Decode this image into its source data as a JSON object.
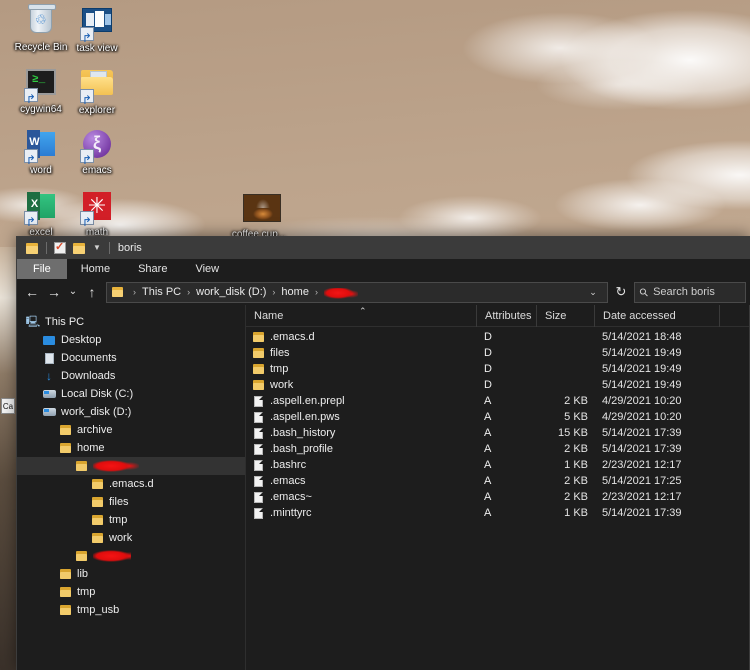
{
  "desktop": {
    "icons": [
      {
        "label": "Recycle Bin",
        "icon": "recycle-bin-icon"
      },
      {
        "label": "task view",
        "icon": "task-view-icon"
      },
      {
        "label": "cygwin64",
        "icon": "cygwin-terminal-icon"
      },
      {
        "label": "explorer",
        "icon": "folder-icon"
      },
      {
        "label": "word",
        "icon": "microsoft-word-icon"
      },
      {
        "label": "emacs",
        "icon": "emacs-icon"
      },
      {
        "label": "excel",
        "icon": "microsoft-excel-icon"
      },
      {
        "label": "math",
        "icon": "mathematica-icon"
      },
      {
        "label": "coffee cup...",
        "icon": "photo-thumbnail-icon"
      }
    ],
    "partial_icon_label": "Ca"
  },
  "window": {
    "title": "boris",
    "quick_access": [
      {
        "name": "folder-icon"
      },
      {
        "name": "properties-icon"
      },
      {
        "name": "new-folder-icon"
      },
      {
        "name": "customize-quick-access-caret"
      }
    ],
    "ribbon_tabs": [
      {
        "label": "File",
        "active": true
      },
      {
        "label": "Home",
        "active": false
      },
      {
        "label": "Share",
        "active": false
      },
      {
        "label": "View",
        "active": false
      }
    ],
    "address": {
      "back_icon": "back-arrow-icon",
      "forward_icon": "forward-arrow-icon",
      "recent_icon": "recent-locations-chevron-icon",
      "up_icon": "up-arrow-icon",
      "breadcrumbs": [
        "This PC",
        "work_disk (D:)",
        "home"
      ],
      "breadcrumb_redacted": true,
      "dropdown_icon": "chevron-down-icon",
      "refresh_icon": "refresh-icon"
    },
    "search": {
      "placeholder": "Search boris",
      "icon": "search-icon"
    }
  },
  "nav_tree": [
    {
      "label": "This PC",
      "icon": "this-pc-icon",
      "indent": 0,
      "selected": false,
      "redacted": false
    },
    {
      "label": "Desktop",
      "icon": "desktop-icon",
      "indent": 1,
      "selected": false,
      "redacted": false
    },
    {
      "label": "Documents",
      "icon": "documents-icon",
      "indent": 1,
      "selected": false,
      "redacted": false
    },
    {
      "label": "Downloads",
      "icon": "downloads-icon",
      "indent": 1,
      "selected": false,
      "redacted": false
    },
    {
      "label": "Local Disk (C:)",
      "icon": "drive-icon",
      "indent": 1,
      "selected": false,
      "redacted": false
    },
    {
      "label": "work_disk (D:)",
      "icon": "drive-icon",
      "indent": 1,
      "selected": false,
      "redacted": false
    },
    {
      "label": "archive",
      "icon": "folder-icon",
      "indent": 2,
      "selected": false,
      "redacted": false
    },
    {
      "label": "home",
      "icon": "folder-icon",
      "indent": 2,
      "selected": false,
      "redacted": false
    },
    {
      "label": "",
      "icon": "folder-icon",
      "indent": 3,
      "selected": true,
      "redacted": true
    },
    {
      "label": ".emacs.d",
      "icon": "folder-icon",
      "indent": 4,
      "selected": false,
      "redacted": false
    },
    {
      "label": "files",
      "icon": "folder-icon",
      "indent": 4,
      "selected": false,
      "redacted": false
    },
    {
      "label": "tmp",
      "icon": "folder-icon",
      "indent": 4,
      "selected": false,
      "redacted": false
    },
    {
      "label": "work",
      "icon": "folder-icon",
      "indent": 4,
      "selected": false,
      "redacted": false
    },
    {
      "label": "",
      "icon": "folder-icon",
      "indent": 3,
      "selected": false,
      "redacted": true
    },
    {
      "label": "lib",
      "icon": "folder-icon",
      "indent": 2,
      "selected": false,
      "redacted": false
    },
    {
      "label": "tmp",
      "icon": "folder-icon",
      "indent": 2,
      "selected": false,
      "redacted": false
    },
    {
      "label": "tmp_usb",
      "icon": "folder-icon",
      "indent": 2,
      "selected": false,
      "redacted": false
    }
  ],
  "file_list": {
    "columns": [
      "Name",
      "Attributes",
      "Size",
      "Date accessed"
    ],
    "sort_column": "Name",
    "sort_direction": "ascending",
    "rows": [
      {
        "name": ".emacs.d",
        "type": "folder",
        "attributes": "D",
        "size": "",
        "date_accessed": "5/14/2021 18:48"
      },
      {
        "name": "files",
        "type": "folder",
        "attributes": "D",
        "size": "",
        "date_accessed": "5/14/2021 19:49"
      },
      {
        "name": "tmp",
        "type": "folder",
        "attributes": "D",
        "size": "",
        "date_accessed": "5/14/2021 19:49"
      },
      {
        "name": "work",
        "type": "folder",
        "attributes": "D",
        "size": "",
        "date_accessed": "5/14/2021 19:49"
      },
      {
        "name": ".aspell.en.prepl",
        "type": "file",
        "attributes": "A",
        "size": "2 KB",
        "date_accessed": "4/29/2021 10:20"
      },
      {
        "name": ".aspell.en.pws",
        "type": "file",
        "attributes": "A",
        "size": "5 KB",
        "date_accessed": "4/29/2021 10:20"
      },
      {
        "name": ".bash_history",
        "type": "file",
        "attributes": "A",
        "size": "15 KB",
        "date_accessed": "5/14/2021 17:39"
      },
      {
        "name": ".bash_profile",
        "type": "file",
        "attributes": "A",
        "size": "2 KB",
        "date_accessed": "5/14/2021 17:39"
      },
      {
        "name": ".bashrc",
        "type": "file",
        "attributes": "A",
        "size": "1 KB",
        "date_accessed": "2/23/2021 12:17"
      },
      {
        "name": ".emacs",
        "type": "file",
        "attributes": "A",
        "size": "2 KB",
        "date_accessed": "5/14/2021 17:25"
      },
      {
        "name": ".emacs~",
        "type": "file",
        "attributes": "A",
        "size": "2 KB",
        "date_accessed": "2/23/2021 12:17"
      },
      {
        "name": ".minttyrc",
        "type": "file",
        "attributes": "A",
        "size": "1 KB",
        "date_accessed": "5/14/2021 17:39"
      }
    ]
  },
  "colors": {
    "window_bg": "#1d1d1d",
    "titlebar_bg": "#3b3b3b",
    "selection_bg": "#333333",
    "folder_yellow": "#f2cb6a",
    "redaction_red": "#e00d0d",
    "desktop_sky": "#c3ab93"
  }
}
